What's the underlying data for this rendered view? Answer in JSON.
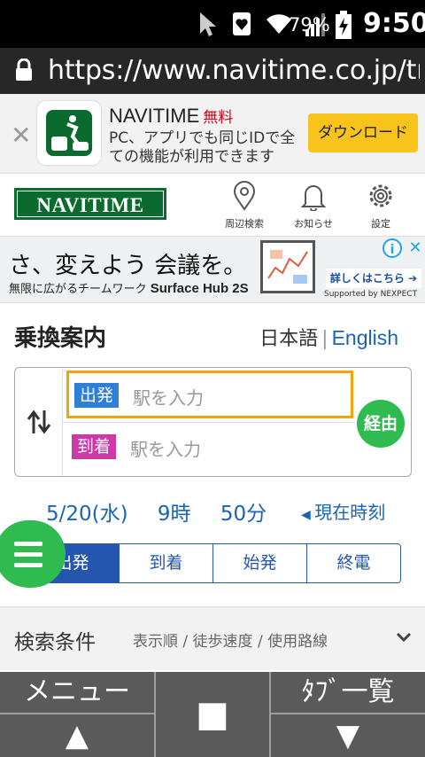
{
  "status_bar": {
    "battery": "79%",
    "time": "9:50"
  },
  "url_bar": {
    "url": "https://www.navitime.co.jp/tr..."
  },
  "app_banner": {
    "app_name": "NAVITIME",
    "free_label": "無料",
    "description": "PC、アプリでも同じIDで全ての機能が利用できます",
    "download_label": "ダウンロード"
  },
  "header": {
    "logo_text": "NAVITIME",
    "nearby_label": "周辺検索",
    "notice_label": "お知らせ",
    "settings_label": "設定"
  },
  "ad": {
    "headline": "さ、変えよう 会議を。",
    "subline": "無限に広がるチームワーク",
    "product": "Surface Hub 2S",
    "cta": "詳しくはこちら ➔",
    "supported": "Supported by NEXPECT",
    "info": "i",
    "close": "✕"
  },
  "page": {
    "title": "乗換案内",
    "lang_ja": "日本語",
    "lang_sep": "|",
    "lang_en": "English"
  },
  "search": {
    "departure_badge": "出発",
    "departure_placeholder": "駅を入力",
    "arrival_badge": "到着",
    "arrival_placeholder": "駅を入力",
    "via_label": "経由"
  },
  "datetime": {
    "date": "5/20(水)",
    "hour": "9時",
    "minute": "50分",
    "now_label": "現在時刻"
  },
  "time_mode_tabs": [
    "出発",
    "到着",
    "始発",
    "終電"
  ],
  "conditions": {
    "heading": "検索条件",
    "summary": "表示順 / 徒歩速度 / 使用路線"
  },
  "bottom_bar": {
    "menu_label": "メニュー",
    "tabs_label": "ﾀﾌﾞ一覧"
  },
  "colors": {
    "brand_green": "#0b6b2e",
    "accent_green": "#2fbb4f",
    "link_blue": "#1a63b5",
    "tab_blue": "#2456b0",
    "highlight_orange": "#f0a30a",
    "download_yellow": "#f8c31a"
  }
}
